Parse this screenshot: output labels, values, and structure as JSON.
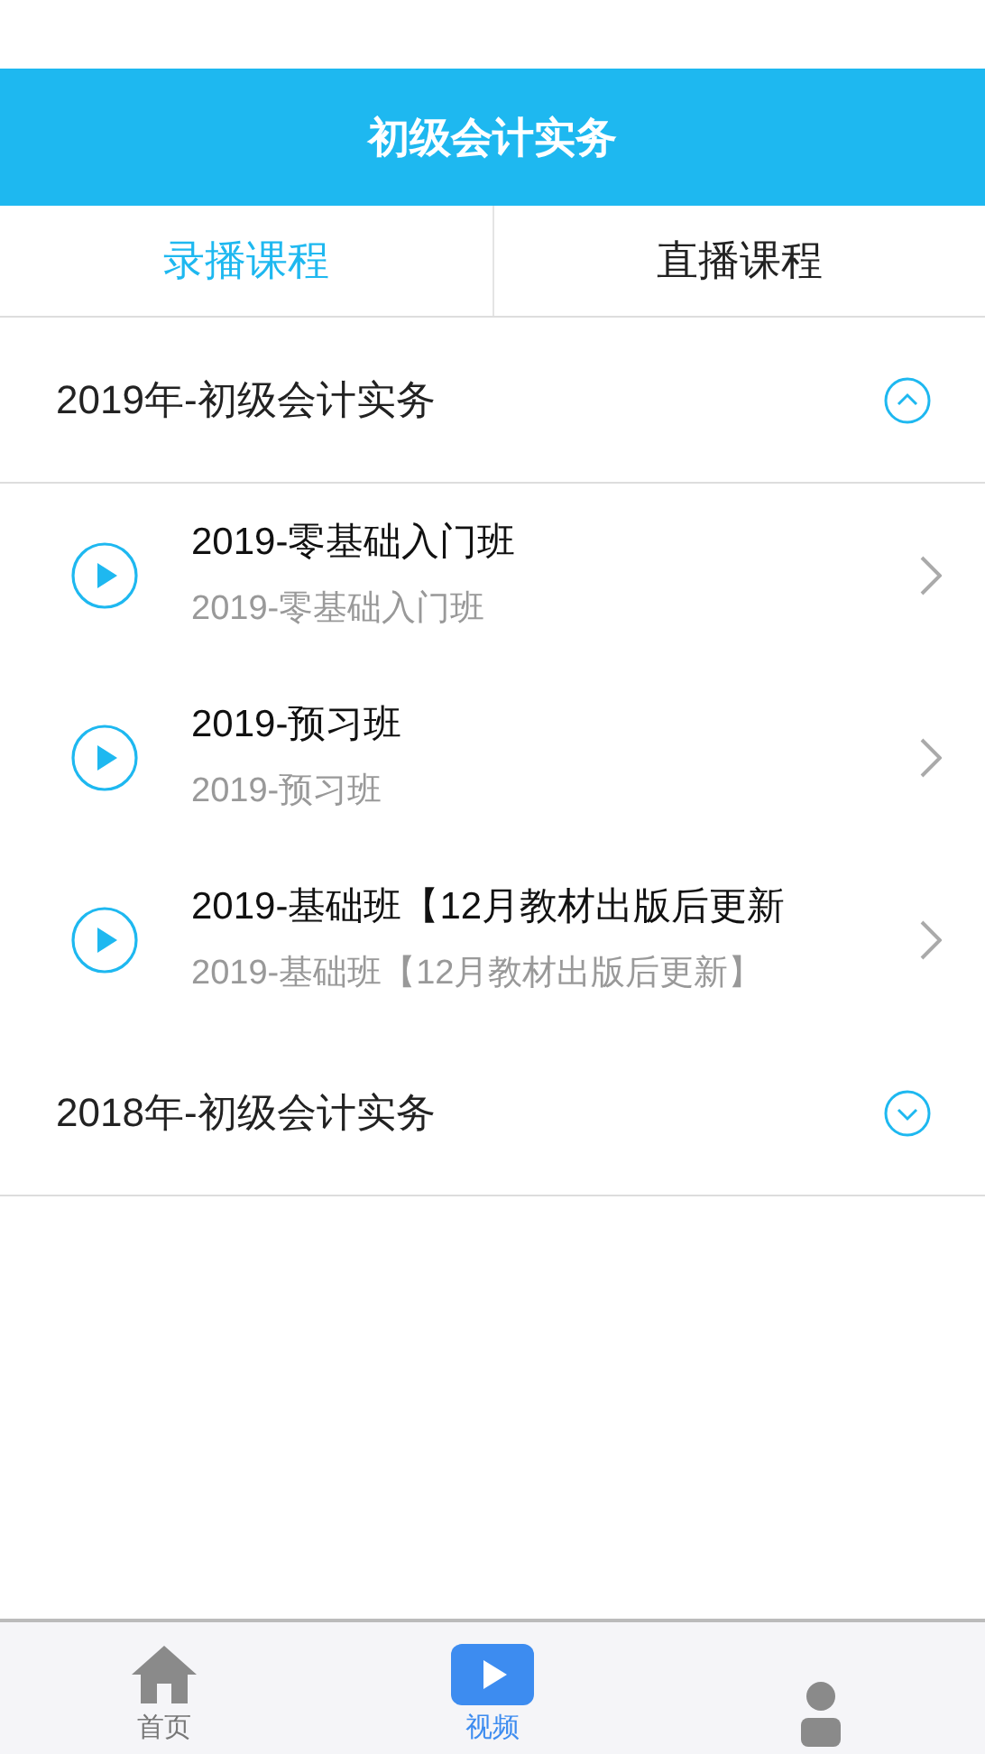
{
  "header": {
    "title": "初级会计实务"
  },
  "tabs": [
    {
      "label": "录播课程",
      "selected": true
    },
    {
      "label": "直播课程",
      "selected": false
    }
  ],
  "sections": [
    {
      "title": "2019年-初级会计实务",
      "expanded": true,
      "courses": [
        {
          "title": "2019-零基础入门班",
          "subtitle": "2019-零基础入门班"
        },
        {
          "title": "2019-预习班",
          "subtitle": "2019-预习班"
        },
        {
          "title": "2019-基础班【12月教材出版后更新",
          "subtitle": "2019-基础班【12月教材出版后更新】"
        }
      ]
    },
    {
      "title": "2018年-初级会计实务",
      "expanded": false
    }
  ],
  "bottom_nav": [
    {
      "kind": "home",
      "label": "首页",
      "selected": false
    },
    {
      "kind": "video",
      "label": "视频",
      "selected": true
    },
    {
      "kind": "person",
      "selected": false
    }
  ]
}
